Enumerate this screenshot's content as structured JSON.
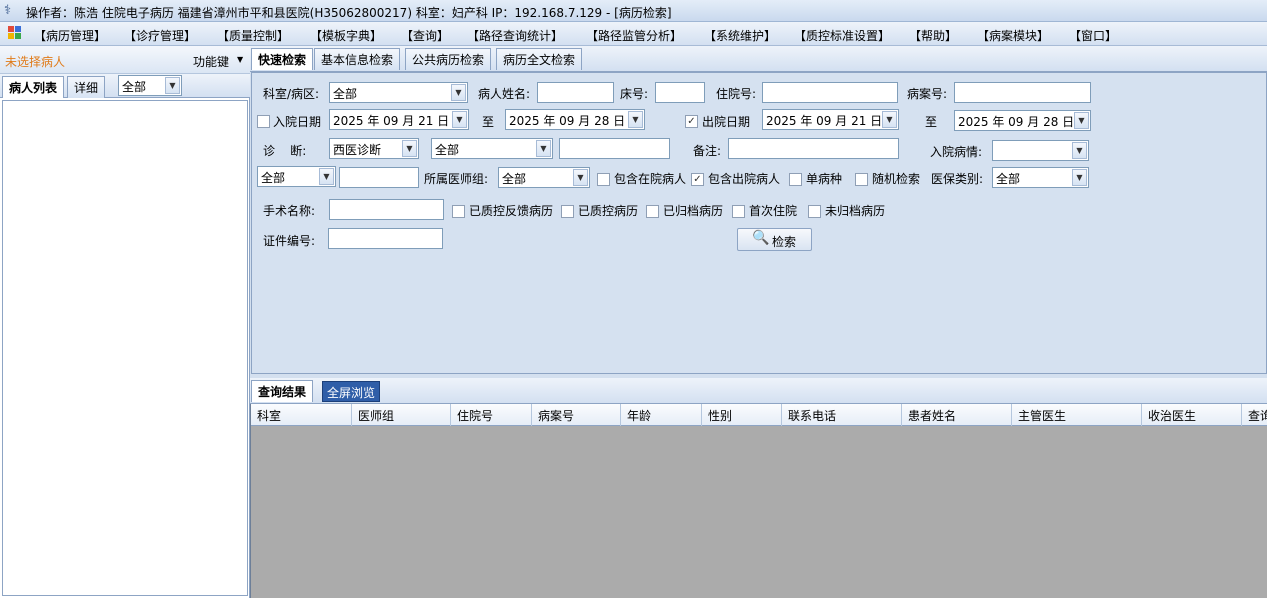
{
  "window": {
    "title": "操作者：陈浩 住院电子病历  福建省漳州市平和县医院(H35062800217)  科室：妇产科  IP：192.168.7.129 - [病历检索]"
  },
  "menu": {
    "items": [
      "【病历管理】",
      "【诊疗管理】",
      "【质量控制】",
      "【模板字典】",
      "【查询】",
      "【路径查询统计】",
      "【路径监管分析】",
      "【系统维护】",
      "【质控标准设置】",
      "【帮助】",
      "【病案模块】",
      "【窗口】"
    ]
  },
  "left_panel": {
    "no_patient": "未选择病人",
    "function_key": "功能键",
    "tabs": [
      "病人列表",
      "详细"
    ],
    "filter_value": "全部"
  },
  "search_tabs": [
    "快速检索",
    "基本信息检索",
    "公共病历检索",
    "病历全文检索"
  ],
  "form": {
    "dept_label": "科室/病区:",
    "dept_value": "全部",
    "name_label": "病人姓名:",
    "bed_label": "床号:",
    "inpatient_no_label": "住院号:",
    "case_no_label": "病案号:",
    "admit_date_label": "入院日期",
    "admit_from": "2025 年 09 月 21 日",
    "to_label": "至",
    "admit_to": "2025 年 09 月 28 日",
    "discharge_date_label": "出院日期",
    "discharge_from": "2025 年 09 月 21 日",
    "discharge_to": "2025 年 09 月 28 日",
    "diagnosis_label": "诊    断:",
    "diagnosis_type": "西医诊断",
    "diagnosis_scope": "全部",
    "remark_label": "备注:",
    "admit_condition_label": "入院病情:",
    "all_select": "全部",
    "doctor_group_label": "所属医师组:",
    "doctor_group_value": "全部",
    "include_inpatient": "包含在院病人",
    "include_discharged": "包含出院病人",
    "single_disease": "单病种",
    "random_search": "随机检索",
    "insurance_label": "医保类别:",
    "insurance_value": "全部",
    "surgery_label": "手术名称:",
    "qc_feedback": "已质控反馈病历",
    "qc_done": "已质控病历",
    "archived": "已归档病历",
    "first_admit": "首次住院",
    "not_archived": "未归档病历",
    "cert_label": "证件编号:",
    "search_button": "检索"
  },
  "results": {
    "tab": "查询结果",
    "fullscreen": "全屏浏览",
    "columns": [
      "科室",
      "医师组",
      "住院号",
      "病案号",
      "年龄",
      "性别",
      "联系电话",
      "患者姓名",
      "主管医生",
      "收治医生",
      "查询"
    ]
  }
}
